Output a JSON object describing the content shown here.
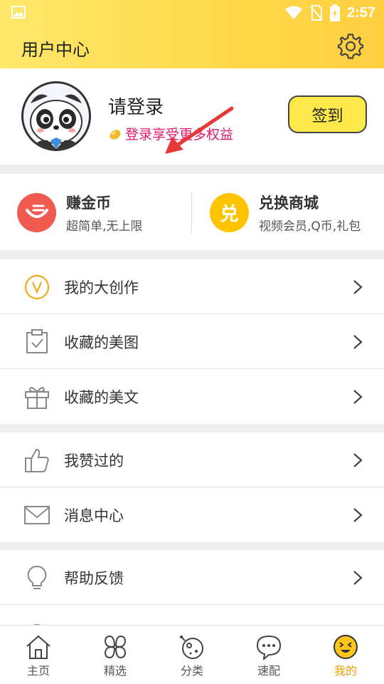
{
  "status_bar": {
    "time": "2:57"
  },
  "header": {
    "title": "用户中心",
    "settings_icon": "gear-icon"
  },
  "profile": {
    "title": "请登录",
    "subtitle": "登录享受更多权益",
    "checkin_label": "签到",
    "checkin_color": "#fde84a",
    "subtitle_color": "#e0196a"
  },
  "coins": {
    "earn": {
      "title": "赚金币",
      "subtitle": "超简单,无上限",
      "color": "#f05a4f"
    },
    "exchange": {
      "title": "兑换商城",
      "subtitle": "视频会员,Q币,礼包",
      "badge": "兑",
      "color": "#ffc400"
    }
  },
  "menu": {
    "group1": [
      {
        "label": "我的大创作",
        "icon": "v-badge-icon"
      },
      {
        "label": "收藏的美图",
        "icon": "clipboard-check-icon"
      },
      {
        "label": "收藏的美文",
        "icon": "gift-icon"
      }
    ],
    "group2": [
      {
        "label": "我赞过的",
        "icon": "thumbs-up-icon"
      },
      {
        "label": "消息中心",
        "icon": "envelope-icon"
      }
    ],
    "group3": [
      {
        "label": "帮助反馈",
        "icon": "lightbulb-icon"
      }
    ]
  },
  "tabs": [
    {
      "label": "主页",
      "icon": "home-icon"
    },
    {
      "label": "精选",
      "icon": "clover-icon"
    },
    {
      "label": "分类",
      "icon": "planet-icon"
    },
    {
      "label": "速配",
      "icon": "chat-bubble-icon"
    },
    {
      "label": "我的",
      "icon": "smiley-icon",
      "active": true
    }
  ],
  "accent_color": "#f0a000"
}
